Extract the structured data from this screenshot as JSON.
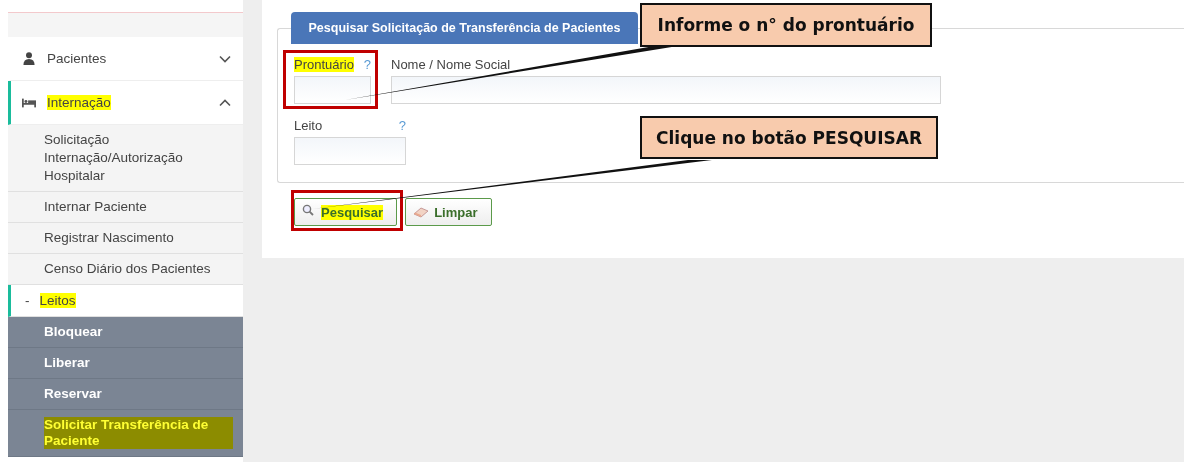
{
  "sidebar": {
    "items": [
      {
        "label": "Pacientes",
        "expanded": false,
        "highlighted": false
      },
      {
        "label": "Internação",
        "expanded": true,
        "highlighted": true,
        "children": [
          {
            "label": "Solicitação Internação/Autorização Hospitalar",
            "highlighted": false
          },
          {
            "label": "Internar Paciente",
            "highlighted": false
          },
          {
            "label": "Registrar Nascimento",
            "highlighted": false
          },
          {
            "label": "Censo Diário dos Pacientes",
            "highlighted": false
          },
          {
            "label": "Leitos",
            "marker": "-",
            "expanded": true,
            "highlighted": true,
            "children": [
              {
                "label": "Bloquear",
                "highlighted": false
              },
              {
                "label": "Liberar",
                "highlighted": false
              },
              {
                "label": "Reservar",
                "highlighted": false
              },
              {
                "label": "Solicitar Transferência de Paciente",
                "highlighted": true
              }
            ]
          }
        ]
      }
    ]
  },
  "form": {
    "title": "Pesquisar Solicitação de Transferência de Pacientes",
    "rows": [
      [
        {
          "label": "Prontuário",
          "help": "?",
          "highlighted": true,
          "boxed": true
        },
        {
          "label": "Nome / Nome Social",
          "highlighted": false,
          "boxed": false
        }
      ],
      [
        {
          "label": "Leito",
          "help": "?",
          "highlighted": false,
          "boxed": false
        }
      ]
    ],
    "buttons": [
      {
        "label": "Pesquisar",
        "highlighted": true,
        "boxed": true
      },
      {
        "label": "Limpar",
        "highlighted": false,
        "boxed": false
      }
    ]
  },
  "callouts": [
    {
      "text": "Informe o n° do prontuário"
    },
    {
      "text": "Clique no botão PESQUISAR"
    }
  ]
}
